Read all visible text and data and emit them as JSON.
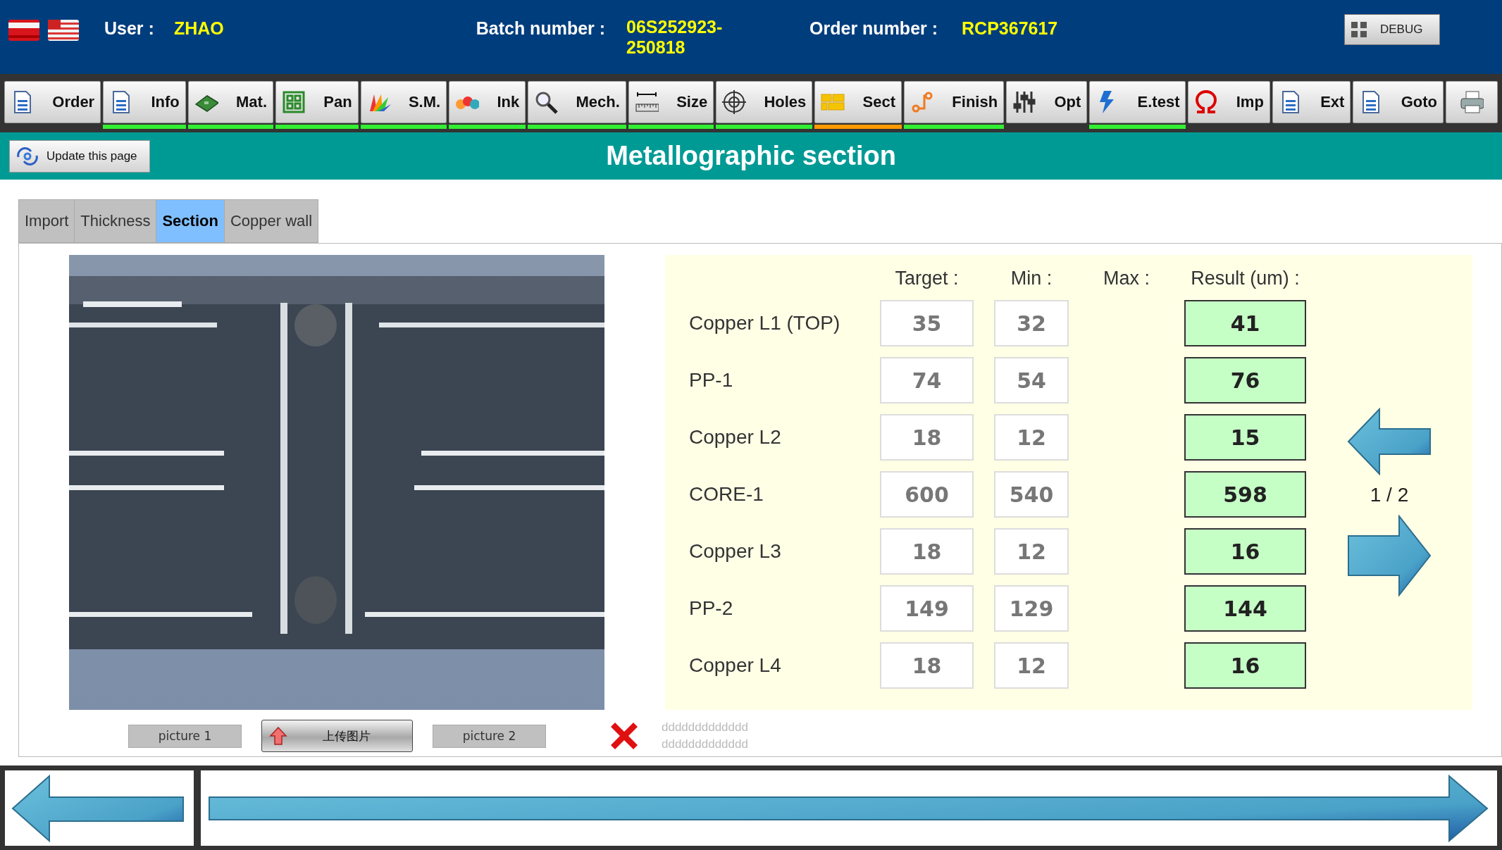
{
  "header": {
    "user": {
      "label": "User :",
      "value": "ZHAO"
    },
    "batch": {
      "label": "Batch number :",
      "value": "06S252923-250818"
    },
    "order": {
      "label": "Order number :",
      "value": "RCP367617"
    },
    "debug_button": "DEBUG"
  },
  "toolbar": [
    {
      "kind": "text",
      "label": "Order",
      "done": false,
      "current": false
    },
    {
      "kind": "text",
      "label": "Info",
      "done": true,
      "current": false
    },
    {
      "kind": "text",
      "label": "Mat.",
      "done": true,
      "current": false
    },
    {
      "kind": "text",
      "label": "Pan",
      "done": true,
      "current": false
    },
    {
      "kind": "text",
      "label": "S.M.",
      "done": true,
      "current": false
    },
    {
      "kind": "text",
      "label": "Ink",
      "done": true,
      "current": false
    },
    {
      "kind": "text",
      "label": "Mech.",
      "done": true,
      "current": false
    },
    {
      "kind": "text",
      "label": "Size",
      "done": true,
      "current": false
    },
    {
      "kind": "text",
      "label": "Holes",
      "done": true,
      "current": false
    },
    {
      "kind": "text",
      "label": "Sect",
      "done": false,
      "current": true
    },
    {
      "kind": "text",
      "label": "Finish",
      "done": true,
      "current": false
    },
    {
      "kind": "text",
      "label": "Opt",
      "done": false,
      "current": false
    },
    {
      "kind": "text",
      "label": "E.test",
      "done": true,
      "current": false
    },
    {
      "kind": "text",
      "label": "Imp",
      "done": false,
      "current": false
    },
    {
      "kind": "text",
      "label": "Ext",
      "done": false,
      "current": false
    },
    {
      "kind": "text",
      "label": "Goto",
      "done": false,
      "current": false
    },
    {
      "kind": "icon",
      "done": false,
      "current": false
    }
  ],
  "update_button": "Update this page",
  "title": "Metallographic section",
  "tabs": [
    {
      "label": "Import",
      "selected": false
    },
    {
      "label": "Thickness",
      "selected": false
    },
    {
      "label": "Section",
      "selected": true
    },
    {
      "label": "Copper wall",
      "selected": false
    }
  ],
  "table": {
    "columns": [
      "Target :",
      "Min :",
      "Max :",
      "Result (um) :"
    ],
    "rows": [
      {
        "name": "Copper L1 (TOP)",
        "target": "35",
        "min": "32",
        "result": "41",
        "pass": true
      },
      {
        "name": "PP-1",
        "target": "74",
        "min": "54",
        "result": "76",
        "pass": true
      },
      {
        "name": "Copper L2",
        "target": "18",
        "min": "12",
        "result": "15",
        "pass": true
      },
      {
        "name": "CORE-1",
        "target": "600",
        "min": "540",
        "result": "598",
        "pass": true
      },
      {
        "name": "Copper L3",
        "target": "18",
        "min": "12",
        "result": "16",
        "pass": true
      },
      {
        "name": "PP-2",
        "target": "149",
        "min": "129",
        "result": "144",
        "pass": true
      },
      {
        "name": "Copper L4",
        "target": "18",
        "min": "12",
        "result": "16",
        "pass": true
      }
    ]
  },
  "pager": "1 / 2",
  "picture_1_button": "picture 1",
  "upload_button": "上传图片",
  "picture_2_button": "picture 2",
  "notes": [
    "ddddddddddddd",
    "ddddddddddddd"
  ]
}
